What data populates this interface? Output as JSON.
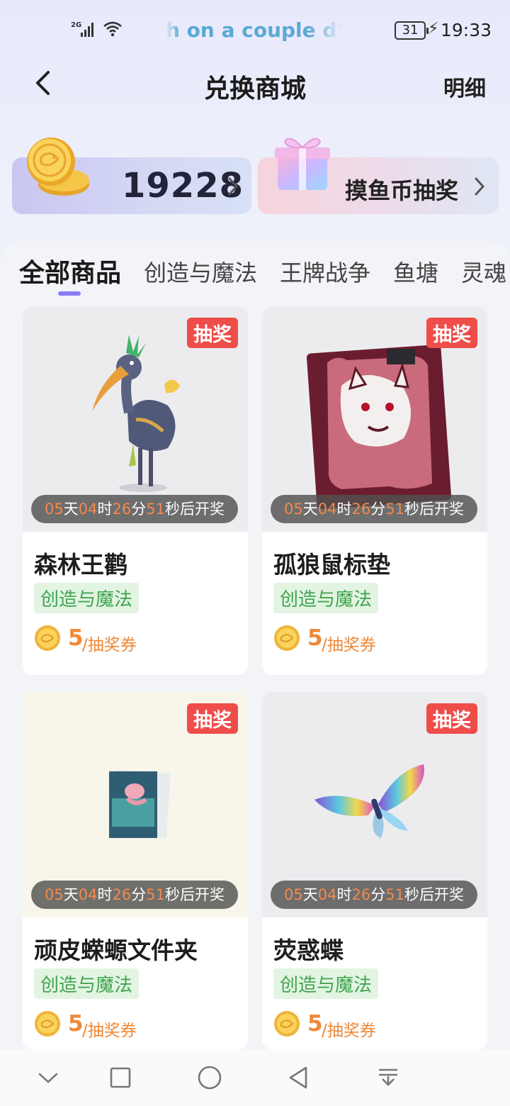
{
  "status_bar": {
    "network": "2G",
    "ticker": "h on a couple d**g",
    "battery": "31",
    "time": "19:33"
  },
  "header": {
    "title": "兑换商城",
    "detail_label": "明细"
  },
  "coins": {
    "amount": "19228"
  },
  "lottery": {
    "label": "摸鱼币抽奖"
  },
  "tabs": [
    {
      "label": "全部商品",
      "active": true
    },
    {
      "label": "创造与魔法",
      "active": false
    },
    {
      "label": "王牌战争",
      "active": false
    },
    {
      "label": "鱼塘",
      "active": false
    },
    {
      "label": "灵魂",
      "active": false
    }
  ],
  "countdown": {
    "days": "05",
    "days_unit": "天",
    "hours": "04",
    "hours_unit": "时",
    "minutes": "26",
    "minutes_unit": "分",
    "seconds": "51",
    "seconds_unit": "秒后开奖"
  },
  "products": [
    {
      "name": "森林王鹳",
      "badge": "抽奖",
      "tag": "创造与魔法",
      "price": "5",
      "unit": "/抽奖券"
    },
    {
      "name": "孤狼鼠标垫",
      "badge": "抽奖",
      "tag": "创造与魔法",
      "price": "5",
      "unit": "/抽奖券"
    },
    {
      "name": "顽皮蝾螈文件夹",
      "badge": "抽奖",
      "tag": "创造与魔法",
      "price": "5",
      "unit": "/抽奖券"
    },
    {
      "name": "荧惑蝶",
      "badge": "抽奖",
      "tag": "创造与魔法",
      "price": "5",
      "unit": "/抽奖券"
    }
  ],
  "colors": {
    "accent": "#8a7cf0",
    "badge": "#ef4d4a",
    "price": "#ee8838",
    "tag_bg": "#e3f4e2",
    "tag_text": "#3fa550"
  },
  "icons": {
    "back": "chevron-left-icon",
    "coin": "fish-coin-icon",
    "gift": "gift-box-icon",
    "nav": [
      "chevron-down-icon",
      "square-icon",
      "circle-icon",
      "triangle-back-icon",
      "notification-pull-icon"
    ]
  }
}
